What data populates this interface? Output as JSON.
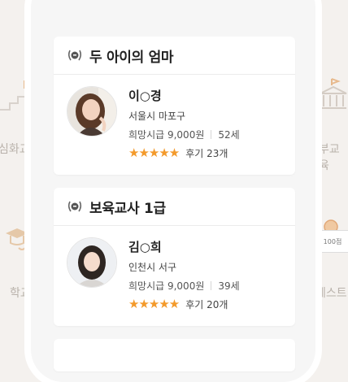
{
  "background": {
    "left_items": [
      "심화교",
      "학교"
    ],
    "right_items": [
      "부교육",
      "테스트"
    ],
    "score_label": "100점"
  },
  "cards": [
    {
      "title": "두 아이의 엄마",
      "name": "이○경",
      "address": "서울시 마포구",
      "wage": "희망시급 9,000원",
      "age": "52세",
      "stars": "★★★★★",
      "reviews": "후기 23개"
    },
    {
      "title": "보육교사 1급",
      "name": "김○희",
      "address": "인천시 서구",
      "wage": "희망시급 9,000원",
      "age": "39세",
      "stars": "★★★★★",
      "reviews": "후기 20개"
    }
  ],
  "colors": {
    "star": "#f39a2b",
    "background": "#f4f1ee"
  }
}
